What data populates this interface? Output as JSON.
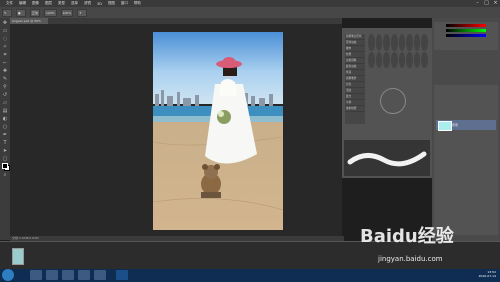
{
  "app": {
    "title": "Photoshop"
  },
  "menubar": {
    "items": [
      "文件",
      "编辑",
      "图像",
      "图层",
      "类型",
      "选择",
      "滤镜",
      "3D",
      "视图",
      "窗口",
      "帮助"
    ]
  },
  "options": {
    "mode_label": "正常",
    "opacity_value": "100%",
    "flow_value": "100%"
  },
  "document": {
    "tab_label": "jingyan.psd @ 50%"
  },
  "status": {
    "text": "文档:2.64M/2.64M"
  },
  "brush_panel": {
    "list": [
      "画笔笔尖形状",
      "形状动态",
      "散布",
      "纹理",
      "双重画笔",
      "颜色动态",
      "传递",
      "画笔笔势",
      "杂色",
      "湿边",
      "建立",
      "平滑",
      "保护纹理"
    ]
  },
  "layers": {
    "layer_name": "背景"
  },
  "watermark": {
    "text": "Baidu经验",
    "url": "jingyan.baidu.com"
  },
  "taskbar": {
    "time": "13:52",
    "date": "2016-07-14"
  },
  "colors": {
    "accent": "#2e7fc1",
    "panel": "#535353"
  }
}
